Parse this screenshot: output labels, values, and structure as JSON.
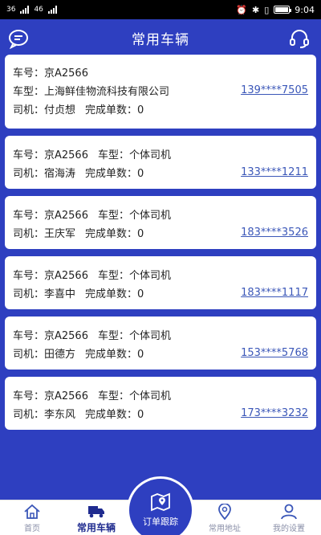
{
  "status_bar": {
    "left_signal_1": "36",
    "left_signal_2": "46",
    "time": "9:04",
    "battery_level": 0.85
  },
  "header": {
    "title": "常用车辆",
    "left_icon": "message-icon",
    "right_icon": "headset-icon"
  },
  "cards": [
    {
      "line1": "车号：京A2566",
      "line2": "车型：上海鲜佳物流科技有限公司",
      "phone": "139****7505",
      "line3_driver": "司机：付贞想",
      "line3_orders": "完成单数：0"
    },
    {
      "plate": "车号：京A2566",
      "type": "车型：个体司机",
      "driver": "司机：宿海涛",
      "orders": "完成单数：0",
      "phone": "133****1211"
    },
    {
      "plate": "车号：京A2566",
      "type": "车型：个体司机",
      "driver": "司机：王庆军",
      "orders": "完成单数：0",
      "phone": "183****3526"
    },
    {
      "plate": "车号：京A2566",
      "type": "车型：个体司机",
      "driver": "司机：李喜中",
      "orders": "完成单数：0",
      "phone": "183****1117"
    },
    {
      "plate": "车号：京A2566",
      "type": "车型：个体司机",
      "driver": "司机：田德方",
      "orders": "完成单数：0",
      "phone": "153****5768"
    },
    {
      "plate": "车号：京A2566",
      "type": "车型：个体司机",
      "driver": "司机：李东风",
      "orders": "完成单数：0",
      "phone": "173****3232"
    }
  ],
  "tabbar": {
    "home": "首页",
    "vehicles": "常用车辆",
    "track": "订单跟踪",
    "address": "常用地址",
    "settings": "我的设置"
  },
  "colors": {
    "primary": "#2E3FC0",
    "link": "#3B57B8",
    "active_tab": "#1f2b8f"
  }
}
